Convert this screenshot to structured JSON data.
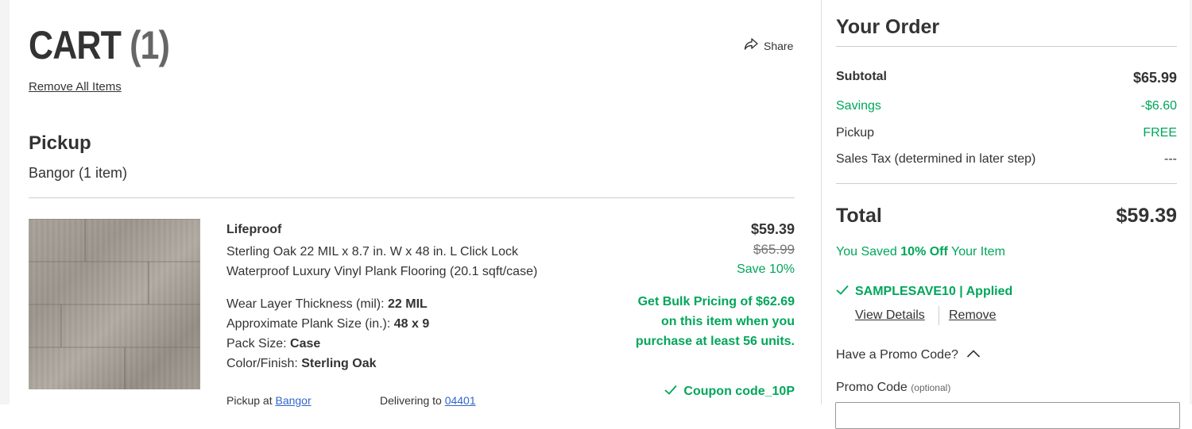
{
  "cart": {
    "title": "CART",
    "count": "(1)",
    "share_label": "Share",
    "remove_all_label": "Remove All Items"
  },
  "pickup": {
    "heading": "Pickup",
    "store_line": "Bangor (1 item)"
  },
  "item": {
    "brand": "Lifeproof",
    "title": "Sterling Oak 22 MIL x 8.7 in. W x 48 in. L Click Lock Waterproof Luxury Vinyl Plank Flooring (20.1 sqft/case)",
    "specs": [
      {
        "label": "Wear Layer Thickness (mil): ",
        "value": "22 MIL"
      },
      {
        "label": "Approximate Plank Size (in.): ",
        "value": "48 x 9"
      },
      {
        "label": "Pack Size: ",
        "value": "Case"
      },
      {
        "label": "Color/Finish: ",
        "value": "Sterling Oak"
      }
    ],
    "price": "$59.39",
    "was_price": "$65.99",
    "save_text": "Save 10%",
    "bulk_pricing": "Get Bulk Pricing of $62.69 on this item when you purchase at least 56 units.",
    "coupon": "Coupon code_10P",
    "pickup_at_label": "Pickup at ",
    "pickup_at_store": "Bangor",
    "delivering_label": "Delivering to ",
    "delivering_zip": "04401"
  },
  "order": {
    "title": "Your Order",
    "subtotal_label": "Subtotal",
    "subtotal_value": "$65.99",
    "savings_label": "Savings",
    "savings_value": "-$6.60",
    "pickup_label": "Pickup",
    "pickup_value": "FREE",
    "tax_label": "Sales Tax (determined in later step)",
    "tax_value": "---",
    "total_label": "Total",
    "total_value": "$59.39",
    "saved_prefix": "You Saved ",
    "saved_bold": "10% Off",
    "saved_suffix": " Your Item",
    "promo_applied": "SAMPLESAVE10 | Applied",
    "view_details": "View Details",
    "remove": "Remove",
    "promo_question": "Have a Promo Code?",
    "promo_label": "Promo Code",
    "promo_optional": "(optional)",
    "promo_value": ""
  },
  "colors": {
    "green": "#00a65a",
    "link_blue": "#3366cc",
    "text": "#333333"
  },
  "icons": [
    "share-icon",
    "check-icon",
    "chevron-up-icon"
  ]
}
